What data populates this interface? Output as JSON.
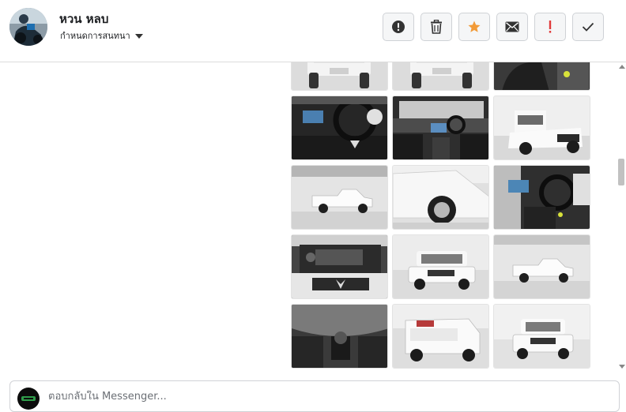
{
  "header": {
    "contact_name": "หวน หลบ",
    "assign_label": "กำหนดการสนทนา",
    "actions": [
      {
        "name": "report-spam-button",
        "icon": "alert-circle-icon"
      },
      {
        "name": "delete-button",
        "icon": "trash-icon"
      },
      {
        "name": "star-button",
        "icon": "star-icon",
        "color": "#f29b38"
      },
      {
        "name": "mark-unread-button",
        "icon": "envelope-icon"
      },
      {
        "name": "follow-up-button",
        "icon": "exclamation-icon",
        "color": "#e03a3a"
      },
      {
        "name": "mark-done-button",
        "icon": "checkmark-icon"
      }
    ]
  },
  "gallery": {
    "photos": [
      "truck-rear-photo",
      "truck-rear-photo",
      "truck-seat-photo",
      "dashboard-photo",
      "interior-wide-photo",
      "truck-front-angle-photo",
      "truck-side-photo",
      "truck-wheel-photo",
      "dashboard-side-photo",
      "engine-bay-photo",
      "truck-front-photo",
      "truck-side-far-photo",
      "gear-shift-photo",
      "truck-rear-angle-photo",
      "truck-front-straight-photo"
    ]
  },
  "composer": {
    "placeholder": "ตอบกลับใน Messenger..."
  }
}
